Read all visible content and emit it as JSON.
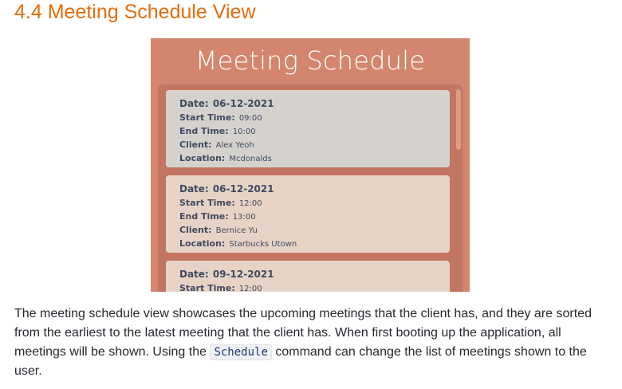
{
  "section": {
    "heading": "4.4 Meeting Schedule View"
  },
  "screenshot": {
    "title": "Meeting Schedule",
    "meetings": [
      {
        "date_label": "Date:",
        "date": "06-12-2021",
        "start_label": "Start Time:",
        "start": "09:00",
        "end_label": "End Time:",
        "end": "10:00",
        "client_label": "Client:",
        "client": "Alex Yeoh",
        "location_label": "Location:",
        "location": "Mcdonalds"
      },
      {
        "date_label": "Date:",
        "date": "06-12-2021",
        "start_label": "Start Time:",
        "start": "12:00",
        "end_label": "End Time:",
        "end": "13:00",
        "client_label": "Client:",
        "client": "Bernice Yu",
        "location_label": "Location:",
        "location": "Starbucks Utown"
      },
      {
        "date_label": "Date:",
        "date": "09-12-2021",
        "start_label": "Start Time:",
        "start": "12:00"
      }
    ],
    "colors": {
      "background": "#d3866d",
      "panel": "#c27560",
      "selected_card": "#d5d2ce",
      "card": "#e7d3c6",
      "scrollbar": "#e39c84"
    }
  },
  "paragraph": {
    "text_before": "The meeting schedule view showcases the upcoming meetings that the client has, and they are sorted from the earliest to the latest meeting that the client has. When first booting up the application, all meetings will be shown. Using the ",
    "code": "Schedule",
    "text_after": " command can change the list of meetings shown to the user."
  },
  "colors": {
    "heading": "#e46c0a",
    "body_text": "#24292f"
  }
}
